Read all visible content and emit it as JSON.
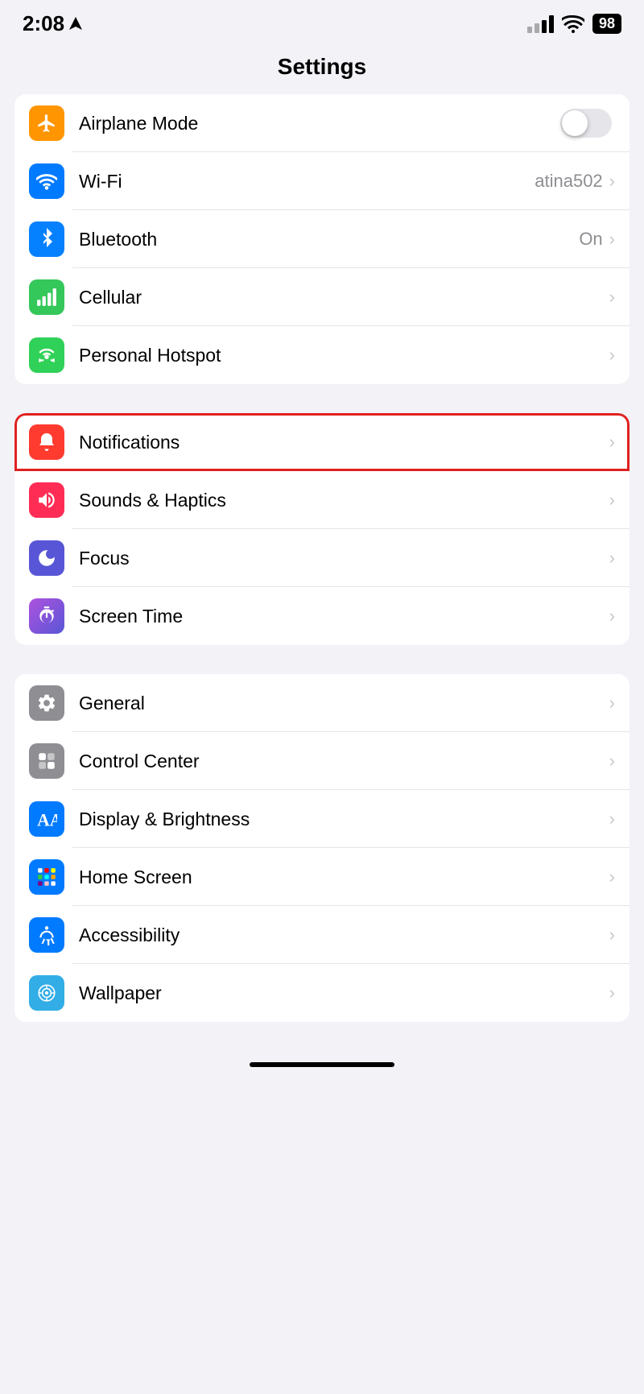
{
  "statusBar": {
    "time": "2:08",
    "locationIcon": "▶",
    "batteryLevel": "98"
  },
  "pageTitle": "Settings",
  "groups": {
    "connectivity": {
      "items": [
        {
          "id": "airplane-mode",
          "label": "Airplane Mode",
          "iconBg": "icon-orange",
          "iconType": "airplane",
          "control": "toggle",
          "value": ""
        },
        {
          "id": "wifi",
          "label": "Wi-Fi",
          "iconBg": "icon-blue",
          "iconType": "wifi",
          "control": "chevron",
          "value": "atina502"
        },
        {
          "id": "bluetooth",
          "label": "Bluetooth",
          "iconBg": "icon-blue-dark",
          "iconType": "bluetooth",
          "control": "chevron",
          "value": "On"
        },
        {
          "id": "cellular",
          "label": "Cellular",
          "iconBg": "icon-green",
          "iconType": "cellular",
          "control": "chevron",
          "value": ""
        },
        {
          "id": "personal-hotspot",
          "label": "Personal Hotspot",
          "iconBg": "icon-green-2",
          "iconType": "hotspot",
          "control": "chevron",
          "value": ""
        }
      ]
    },
    "notifications": {
      "items": [
        {
          "id": "notifications",
          "label": "Notifications",
          "iconBg": "icon-red",
          "iconType": "bell",
          "control": "chevron",
          "value": "",
          "highlighted": true
        },
        {
          "id": "sounds-haptics",
          "label": "Sounds & Haptics",
          "iconBg": "icon-pink",
          "iconType": "sound",
          "control": "chevron",
          "value": ""
        },
        {
          "id": "focus",
          "label": "Focus",
          "iconBg": "icon-purple",
          "iconType": "moon",
          "control": "chevron",
          "value": ""
        },
        {
          "id": "screen-time",
          "label": "Screen Time",
          "iconBg": "icon-purple-2",
          "iconType": "hourglass",
          "control": "chevron",
          "value": ""
        }
      ]
    },
    "general": {
      "items": [
        {
          "id": "general",
          "label": "General",
          "iconBg": "icon-gray",
          "iconType": "gear",
          "control": "chevron",
          "value": ""
        },
        {
          "id": "control-center",
          "label": "Control Center",
          "iconBg": "icon-gray",
          "iconType": "switches",
          "control": "chevron",
          "value": ""
        },
        {
          "id": "display-brightness",
          "label": "Display & Brightness",
          "iconBg": "icon-blue",
          "iconType": "display",
          "control": "chevron",
          "value": ""
        },
        {
          "id": "home-screen",
          "label": "Home Screen",
          "iconBg": "icon-blue",
          "iconType": "homescreen",
          "control": "chevron",
          "value": ""
        },
        {
          "id": "accessibility",
          "label": "Accessibility",
          "iconBg": "icon-blue",
          "iconType": "accessibility",
          "control": "chevron",
          "value": ""
        },
        {
          "id": "wallpaper",
          "label": "Wallpaper",
          "iconBg": "icon-teal",
          "iconType": "wallpaper",
          "control": "chevron",
          "value": ""
        }
      ]
    }
  }
}
